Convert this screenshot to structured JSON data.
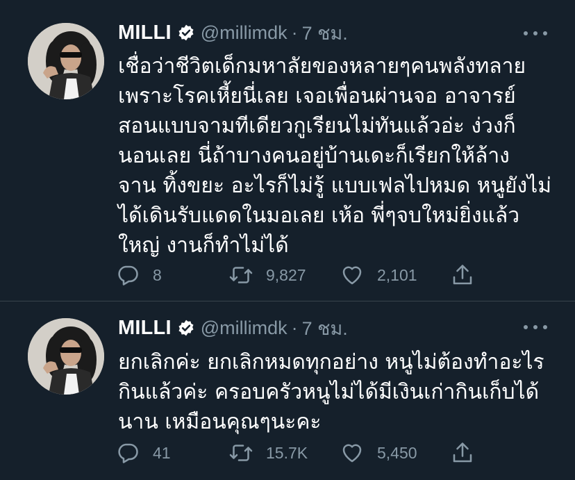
{
  "tweets": [
    {
      "name": "MILLI",
      "handle": "@millimdk",
      "separator": "·",
      "time": "7 ชม.",
      "text": "เชื่อว่าชีวิตเด็กมหาลัยของหลายๆคนพลังทลาย\nเพราะโรคเหี้ยนี่เลย เจอเพื่อนผ่านจอ อาจารย์\nสอนแบบจามทีเดียวกูเรียนไม่ทันแล้วอ่ะ ง่วงก็\nนอนเลย นี่ถ้าบางคนอยู่บ้านเดะก็เรียกให้ล้าง\nจาน ทิ้งขยะ อะไรก็ไม่รู้ แบบเฟลไปหมด หนูยังไม่\nได้เดินรับแดดในมอเลย เห้อ พี่ๆจบใหม่ยิ่งแล้ว\nใหญ่ งานก็ทำไม่ได้",
      "replies": "8",
      "retweets": "9,827",
      "likes": "2,101"
    },
    {
      "name": "MILLI",
      "handle": "@millimdk",
      "separator": "·",
      "time": "7 ชม.",
      "text": "ยกเลิกค่ะ ยกเลิกหมดทุกอย่าง หนูไม่ต้องทำอะไร\nกินแล้วค่ะ ครอบครัวหนูไม่ได้มีเงินเก่ากินเก็บได้\nนาน เหมือนคุณๆนะคะ",
      "replies": "41",
      "retweets": "15.7K",
      "likes": "5,450"
    }
  ],
  "icons": {
    "verified": "verified-badge-icon",
    "more": "more-dots-icon",
    "reply": "reply-icon",
    "retweet": "retweet-icon",
    "like": "like-icon",
    "share": "share-icon"
  },
  "colors": {
    "background": "#15202b",
    "secondary_text": "#8899a6",
    "divider": "#38444d"
  }
}
